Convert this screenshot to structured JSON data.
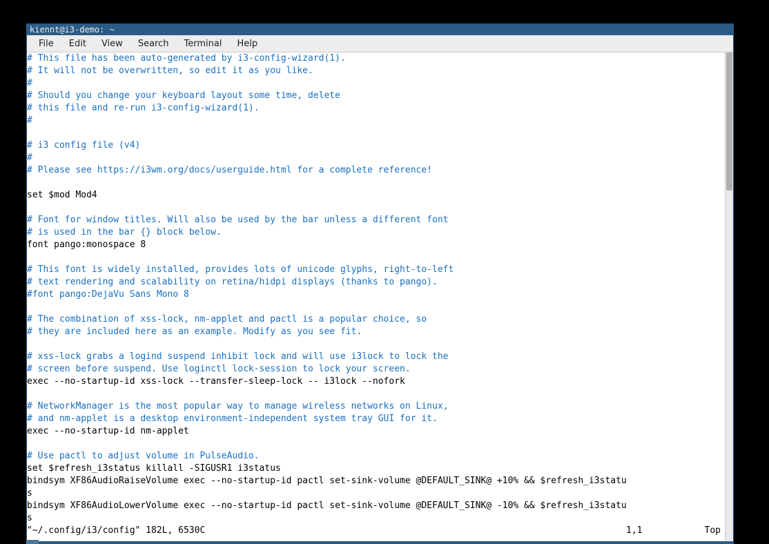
{
  "titlebar": {
    "text": "kiennt@i3-demo: ~"
  },
  "menubar": {
    "items": [
      "File",
      "Edit",
      "View",
      "Search",
      "Terminal",
      "Help"
    ]
  },
  "editor": {
    "lines": [
      {
        "t": "c",
        "s": "# This file has been auto-generated by i3-config-wizard(1)."
      },
      {
        "t": "c",
        "s": "# It will not be overwritten, so edit it as you like."
      },
      {
        "t": "c",
        "s": "#"
      },
      {
        "t": "c",
        "s": "# Should you change your keyboard layout some time, delete"
      },
      {
        "t": "c",
        "s": "# this file and re-run i3-config-wizard(1)."
      },
      {
        "t": "c",
        "s": "#"
      },
      {
        "t": "p",
        "s": ""
      },
      {
        "t": "c",
        "s": "# i3 config file (v4)"
      },
      {
        "t": "c",
        "s": "#"
      },
      {
        "t": "c",
        "s": "# Please see https://i3wm.org/docs/userguide.html for a complete reference!"
      },
      {
        "t": "p",
        "s": ""
      },
      {
        "t": "p",
        "s": "set $mod Mod4"
      },
      {
        "t": "p",
        "s": ""
      },
      {
        "t": "c",
        "s": "# Font for window titles. Will also be used by the bar unless a different font"
      },
      {
        "t": "c",
        "s": "# is used in the bar {} block below."
      },
      {
        "t": "p",
        "s": "font pango:monospace 8"
      },
      {
        "t": "p",
        "s": ""
      },
      {
        "t": "c",
        "s": "# This font is widely installed, provides lots of unicode glyphs, right-to-left"
      },
      {
        "t": "c",
        "s": "# text rendering and scalability on retina/hidpi displays (thanks to pango)."
      },
      {
        "t": "c",
        "s": "#font pango:DejaVu Sans Mono 8"
      },
      {
        "t": "p",
        "s": ""
      },
      {
        "t": "c",
        "s": "# The combination of xss-lock, nm-applet and pactl is a popular choice, so"
      },
      {
        "t": "c",
        "s": "# they are included here as an example. Modify as you see fit."
      },
      {
        "t": "p",
        "s": ""
      },
      {
        "t": "c",
        "s": "# xss-lock grabs a logind suspend inhibit lock and will use i3lock to lock the"
      },
      {
        "t": "c",
        "s": "# screen before suspend. Use loginctl lock-session to lock your screen."
      },
      {
        "t": "p",
        "s": "exec --no-startup-id xss-lock --transfer-sleep-lock -- i3lock --nofork"
      },
      {
        "t": "p",
        "s": ""
      },
      {
        "t": "c",
        "s": "# NetworkManager is the most popular way to manage wireless networks on Linux,"
      },
      {
        "t": "c",
        "s": "# and nm-applet is a desktop environment-independent system tray GUI for it."
      },
      {
        "t": "p",
        "s": "exec --no-startup-id nm-applet"
      },
      {
        "t": "p",
        "s": ""
      },
      {
        "t": "c",
        "s": "# Use pactl to adjust volume in PulseAudio."
      },
      {
        "t": "p",
        "s": "set $refresh_i3status killall -SIGUSR1 i3status"
      },
      {
        "t": "p",
        "s": "bindsym XF86AudioRaiseVolume exec --no-startup-id pactl set-sink-volume @DEFAULT_SINK@ +10% && $refresh_i3status"
      },
      {
        "t": "p",
        "s": "bindsym XF86AudioLowerVolume exec --no-startup-id pactl set-sink-volume @DEFAULT_SINK@ -10% && $refresh_i3status"
      }
    ],
    "status": {
      "file": "\"~/.config/i3/config\" 182L, 6530C",
      "position": "1,1",
      "scroll": "Top"
    }
  }
}
